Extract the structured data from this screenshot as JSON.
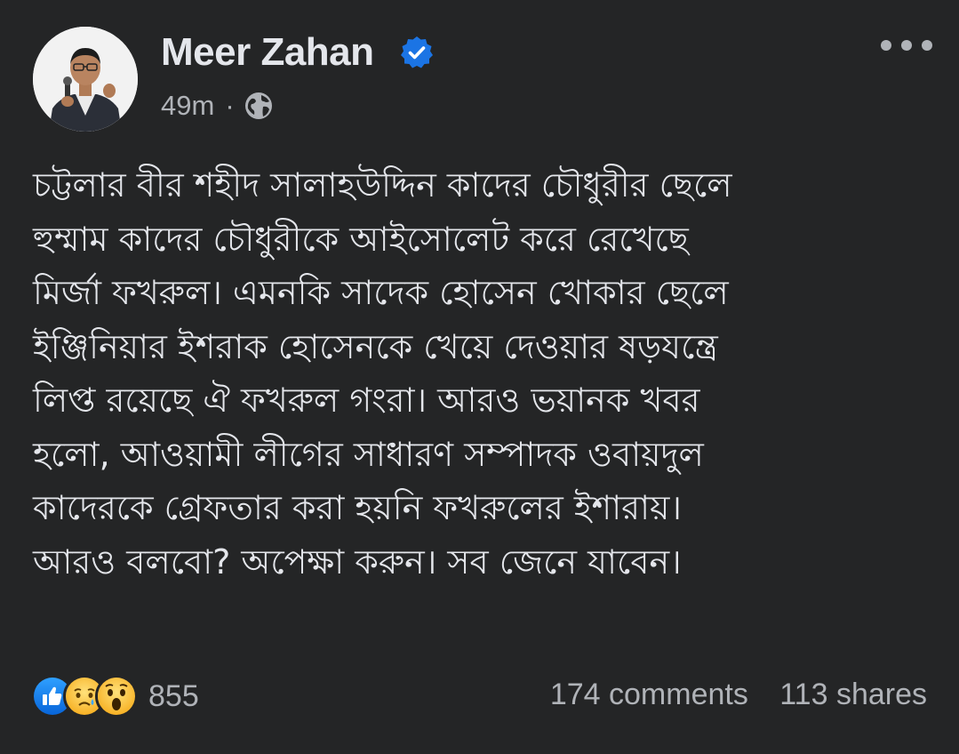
{
  "post": {
    "author": {
      "name": "Meer Zahan",
      "verified": true,
      "avatar": "profile-photo"
    },
    "meta": {
      "time": "49m",
      "separator": "·",
      "privacy_icon": "globe-icon"
    },
    "more_icon": "more-options-icon",
    "text": "চট্টলার বীর শহীদ সালাহউদ্দিন কাদের চৌধুরীর ছেলে\nহুম্মাম কাদের চৌধুরীকে আইসোলেট করে রেখেছে\nমির্জা ফখরুল। এমনকি সাদেক হোসেন খোকার ছেলে\nইঞ্জিনিয়ার ইশরাক হোসেনকে খেয়ে দেওয়ার ষড়যন্ত্রে\nলিপ্ত রয়েছে ঐ ফখরুল গংরা। আরও ভয়ানক খবর\nহলো, আওয়ামী লীগের সাধারণ সম্পাদক ওবায়দুল\nকাদেরকে গ্রেফতার করা হয়নি ফখরুলের ইশারায়।\nআরও বলবো? অপেক্ষা করুন। সব জেনে যাবেন।",
    "reactions": {
      "icons": [
        "like-icon",
        "sad-icon",
        "wow-icon"
      ],
      "count": "855"
    },
    "stats": {
      "comments": "174 comments",
      "shares": "113 shares"
    }
  },
  "colors": {
    "background": "#242526",
    "primary_text": "#e4e6eb",
    "secondary_text": "#b0b3b8",
    "verified_blue": "#1b74e4"
  }
}
